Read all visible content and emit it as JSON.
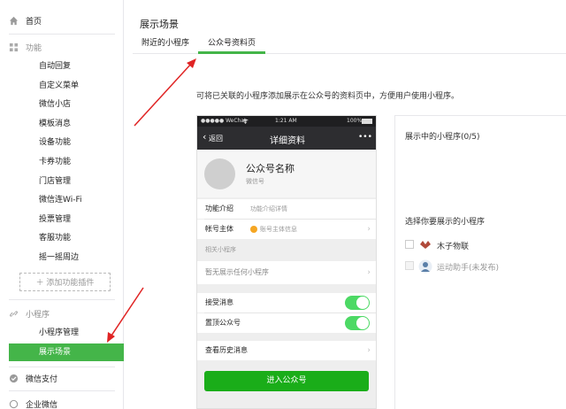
{
  "colors": {
    "accent": "#44b549",
    "arrow": "#e02424",
    "phone_nav": "#2d2d30",
    "toggle_on": "#4cd964",
    "enter_button": "#1aad19"
  },
  "sidebar": {
    "home": {
      "label": "首页",
      "icon": "home-icon"
    },
    "feature": {
      "label": "功能",
      "icon": "grid-icon",
      "items": [
        "自动回复",
        "自定义菜单",
        "微信小店",
        "模板消息",
        "设备功能",
        "卡券功能",
        "门店管理",
        "微信连Wi-Fi",
        "投票管理",
        "客服功能",
        "摇一摇周边"
      ],
      "add_plugin": "＋ 添加功能插件"
    },
    "miniprogram": {
      "label": "小程序",
      "icon": "link-icon",
      "items": [
        "小程序管理"
      ],
      "active_item": "展示场景"
    },
    "pay": {
      "label": "微信支付",
      "icon": "wechat-pay-icon"
    },
    "work": {
      "label": "企业微信",
      "icon": "work-wechat-icon"
    }
  },
  "main": {
    "title": "展示场景",
    "tabs": [
      {
        "label": "附近的小程序",
        "active": false
      },
      {
        "label": "公众号资料页",
        "active": true
      }
    ],
    "description": "可将已关联的小程序添加展示在公众号的资料页中，方便用户使用小程序。"
  },
  "phone": {
    "status": {
      "carrier": "●●●●● WeChat",
      "wifi_icon": "wifi-icon",
      "time": "1:21 AM",
      "battery": "100%"
    },
    "nav": {
      "back": "返回",
      "title": "详细资料",
      "more": "•••"
    },
    "profile": {
      "name": "公众号名称",
      "sub": "微信号"
    },
    "rows": [
      {
        "key": "功能介绍",
        "value": "功能介绍详情"
      },
      {
        "key": "帐号主体",
        "value": "账号主体信息"
      }
    ],
    "related_header": "相关小程序",
    "related_empty": "暂无展示任何小程序",
    "toggles": [
      {
        "label": "接受消息",
        "on": true
      },
      {
        "label": "置顶公众号",
        "on": true
      }
    ],
    "history": "查看历史消息",
    "enter_button": "进入公众号"
  },
  "panel": {
    "displayed": "展示中的小程序(0/5)",
    "choose": "选择你要展示的小程序",
    "options": [
      {
        "name": "木子物联",
        "icon": "muzi-logo-icon",
        "checked": false,
        "enabled": true
      },
      {
        "name": "运动助手(未发布)",
        "icon": "sport-logo-icon",
        "checked": false,
        "enabled": false
      }
    ]
  }
}
